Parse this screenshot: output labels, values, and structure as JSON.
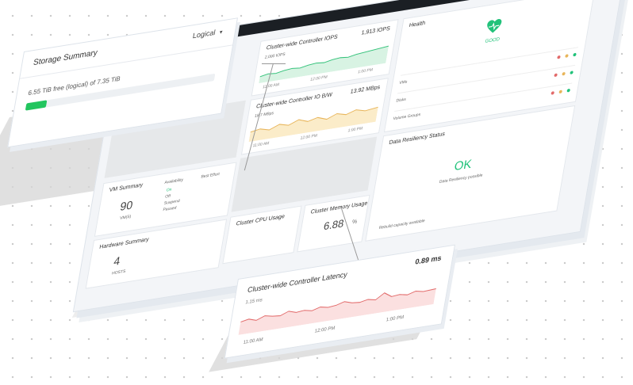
{
  "storage_summary": {
    "title": "Storage Summary",
    "mode": "Logical",
    "free_text": "6.55 TiB free (logical) of 7.35 TiB",
    "used_fraction": 0.11
  },
  "iops": {
    "title": "Cluster-wide Controller IOPS",
    "value": "1,913 IOPS",
    "axis": "2,000 IOPS",
    "times": [
      "11:00 AM",
      "12:00 PM",
      "1:00 PM"
    ]
  },
  "bandwidth": {
    "title": "Cluster-wide Controller IO B/W",
    "value": "13.92 MBps",
    "axis": "18.7 MBps",
    "times": [
      "11:00 AM",
      "12:00 PM",
      "1:00 PM"
    ]
  },
  "health": {
    "title": "Health",
    "status": "GOOD",
    "rows": [
      "VMs",
      "Disks",
      "Volume Groups"
    ]
  },
  "resiliency": {
    "title": "Data Resiliency Status",
    "status": "OK",
    "caption": "Data Resiliency possible",
    "footer": "Rebuild capacity available"
  },
  "vm_summary": {
    "title": "VM Summary",
    "count": "90",
    "count_label": "VM(S)",
    "availability": "Availability",
    "best_effort": "Best Effort",
    "states": [
      "On",
      "Off",
      "Suspend",
      "Paused"
    ]
  },
  "hardware_summary": {
    "title": "Hardware Summary",
    "hosts": "4",
    "hosts_label": "HOSTS"
  },
  "cpu": {
    "title": "Cluster CPU Usage"
  },
  "memory": {
    "title": "Cluster Memory Usage",
    "value": "6.88",
    "unit": "%"
  },
  "latency": {
    "title": "Cluster-wide Controller Latency",
    "value": "0.89 ms",
    "axis": "1.15 ms",
    "times": [
      "11:00 AM",
      "12:00 PM",
      "1:00 PM"
    ]
  },
  "colors": {
    "green": "#22c55e",
    "health_green": "#21c27a",
    "iops_line": "#34c27a",
    "bw_line": "#e8b55a",
    "latency_line": "#e26a6a",
    "topbar": "#1b1f24"
  }
}
